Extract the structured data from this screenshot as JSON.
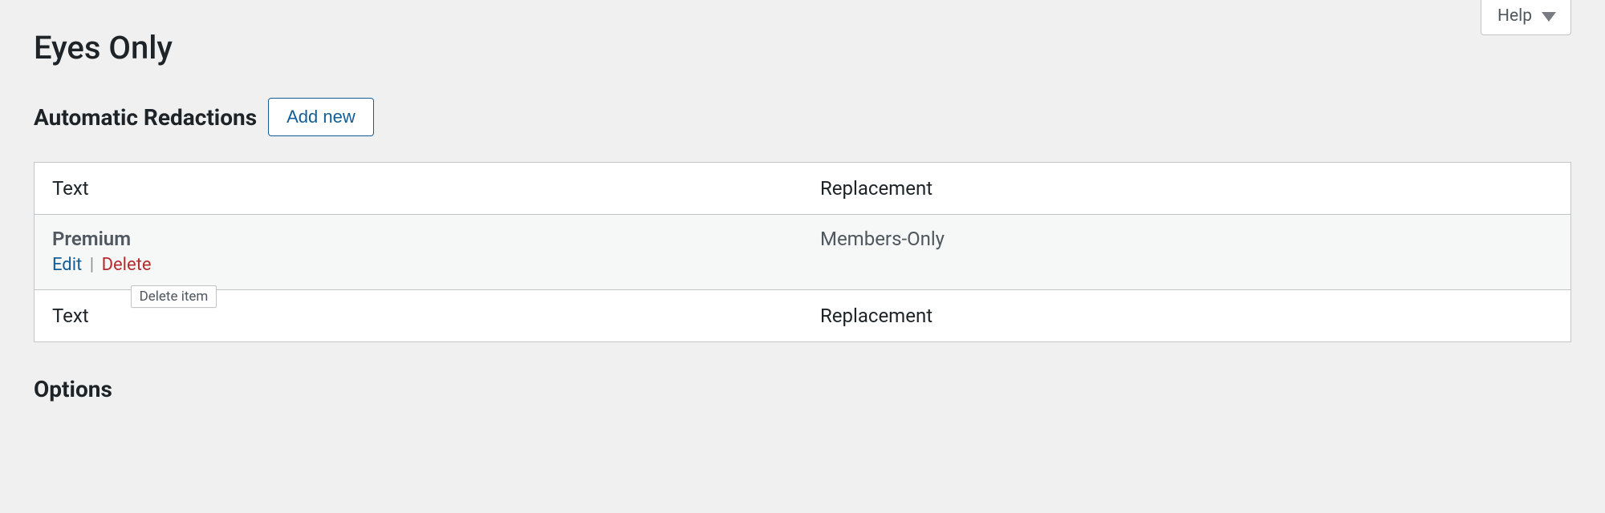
{
  "help": {
    "label": "Help"
  },
  "page": {
    "title": "Eyes Only"
  },
  "section": {
    "title": "Automatic Redactions",
    "add_new_label": "Add new"
  },
  "table": {
    "columns": {
      "text": "Text",
      "replacement": "Replacement"
    },
    "rows": [
      {
        "text": "Premium",
        "replacement": "Members-Only",
        "actions": {
          "edit": "Edit",
          "separator": "|",
          "delete": "Delete",
          "delete_tooltip": "Delete item"
        }
      }
    ],
    "footer": {
      "text": "Text",
      "replacement": "Replacement"
    }
  },
  "options": {
    "title": "Options"
  }
}
